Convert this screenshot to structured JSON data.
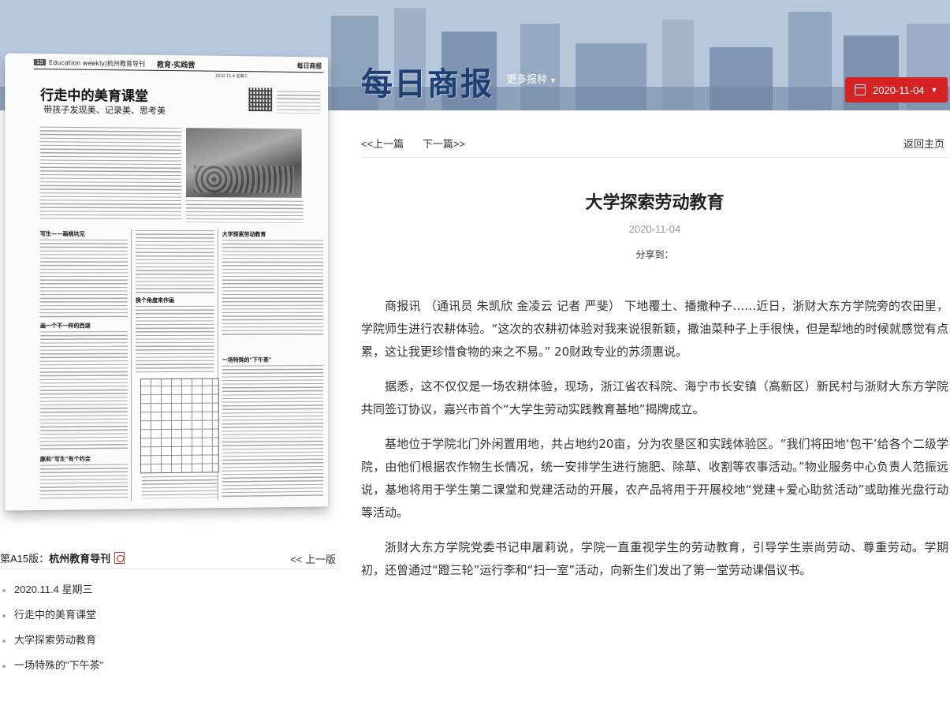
{
  "header": {
    "logo": "每日商报",
    "more_papers": "更多报种",
    "date_button": "2020-11-04"
  },
  "newspaper": {
    "page_number": "15",
    "header_left": "Education weekly|杭州教育导刊",
    "header_mid": "教育·实践营",
    "header_right": "每日商报",
    "header_date": "2020.11.4 星期三",
    "main_title": "行走中的美育课堂",
    "subtitle": "带孩子发现美、记录美、思考美",
    "section_1": "写生——画桃坑见",
    "section_2": "画一个不一样的西湖",
    "section_3": "豚和\"写生\"有个约会",
    "section_4": "换个角度来作画",
    "section_5": "大学探索劳动教育",
    "section_6": "一场特殊的\"下午茶\""
  },
  "edition": {
    "prefix": "第A15版：",
    "name": "杭州教育导刊",
    "prev_label": "<< 上一版"
  },
  "toc": [
    "2020.11.4 星期三",
    "行走中的美育课堂",
    "大学探索劳动教育",
    "一场特殊的\"下午茶\""
  ],
  "article_nav": {
    "prev": "<<上一篇",
    "next": "下一篇>>",
    "home": "返回主页"
  },
  "article": {
    "title": "大学探索劳动教育",
    "date": "2020-11-04",
    "share": "分享到：",
    "paragraphs": [
      "商报讯 （通讯员 朱凯欣 金凌云 记者 严斐） 下地覆土、播撒种子……近日，浙财大东方学院旁的农田里，学院师生进行农耕体验。“这次的农耕初体验对我来说很新颖，撒油菜种子上手很快，但是犁地的时候就感觉有点累，这让我更珍惜食物的来之不易。” 20财政专业的苏须惠说。",
      "据悉，这不仅仅是一场农耕体验，现场，浙江省农科院、海宁市长安镇（高新区）新民村与浙财大东方学院共同签订协议，嘉兴市首个“大学生劳动实践教育基地”揭牌成立。",
      "基地位于学院北门外闲置用地，共占地约20亩，分为农垦区和实践体验区。“我们将田地‘包干’给各个二级学院，由他们根据农作物生长情况，统一安排学生进行施肥、除草、收割等农事活动。”物业服务中心负责人范振远说，基地将用于学生第二课堂和党建活动的开展，农产品将用于开展校地“党建+爱心助贫活动”或助推光盘行动等活动。",
      "浙财大东方学院党委书记申屠莉说，学院一直重视学生的劳动教育，引导学生崇尚劳动、尊重劳动。学期初，还曾通过“蹬三轮”运行李和“扫一室”活动，向新生们发出了第一堂劳动课倡议书。"
    ]
  }
}
